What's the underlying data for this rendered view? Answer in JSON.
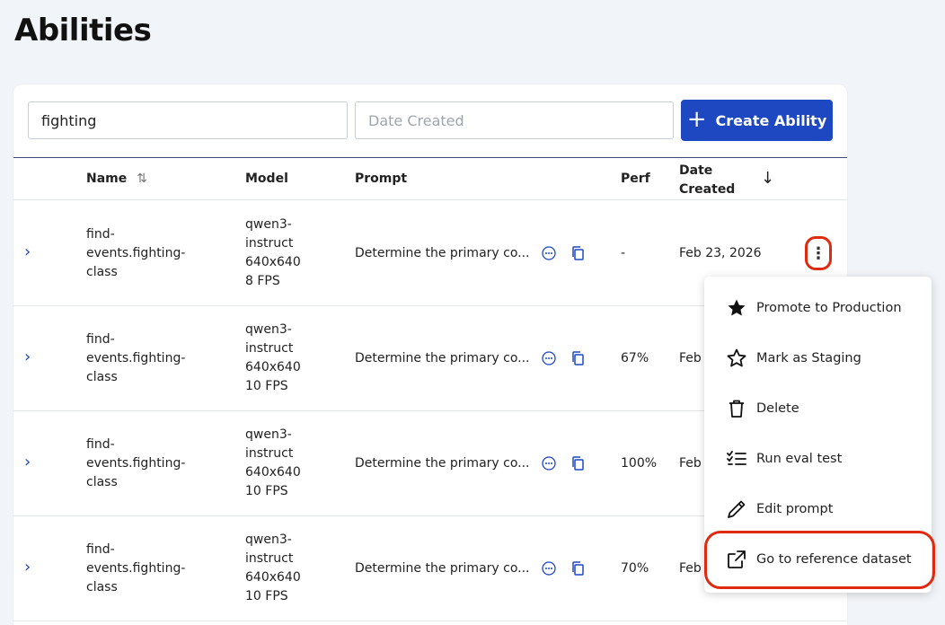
{
  "page": {
    "title": "Abilities"
  },
  "toolbar": {
    "search_value": "fighting",
    "date_placeholder": "Date Created",
    "create_label": "Create Ability"
  },
  "table": {
    "headers": {
      "name": "Name",
      "model": "Model",
      "prompt": "Prompt",
      "perf": "Perf",
      "date_line1": "Date",
      "date_line2": "Created"
    },
    "rows": [
      {
        "name1": "find-",
        "name2": "events.fighting-",
        "name3": "class",
        "model1": "qwen3-",
        "model2": "instruct",
        "model3": "640x640",
        "model4": "8 FPS",
        "prompt": "Determine the primary co...",
        "perf": "-",
        "date": "Feb 23, 2026"
      },
      {
        "name1": "find-",
        "name2": "events.fighting-",
        "name3": "class",
        "model1": "qwen3-",
        "model2": "instruct",
        "model3": "640x640",
        "model4": "10 FPS",
        "prompt": "Determine the primary co...",
        "perf": "67%",
        "date": "Feb"
      },
      {
        "name1": "find-",
        "name2": "events.fighting-",
        "name3": "class",
        "model1": "qwen3-",
        "model2": "instruct",
        "model3": "640x640",
        "model4": "10 FPS",
        "prompt": "Determine the primary co...",
        "perf": "100%",
        "date": "Feb"
      },
      {
        "name1": "find-",
        "name2": "events.fighting-",
        "name3": "class",
        "model1": "qwen3-",
        "model2": "instruct",
        "model3": "640x640",
        "model4": "10 FPS",
        "prompt": "Determine the primary co...",
        "perf": "70%",
        "date": "Feb"
      }
    ]
  },
  "menu": {
    "items": [
      {
        "label": "Promote to Production",
        "icon": "star-filled-icon"
      },
      {
        "label": "Mark as Staging",
        "icon": "star-outline-icon"
      },
      {
        "label": "Delete",
        "icon": "trash-icon"
      },
      {
        "label": "Run eval test",
        "icon": "checklist-icon"
      },
      {
        "label": "Edit prompt",
        "icon": "pencil-icon"
      },
      {
        "label": "Go to reference dataset",
        "icon": "external-link-icon"
      }
    ]
  },
  "colors": {
    "accent": "#1e47c2",
    "highlight": "#e02a10"
  }
}
